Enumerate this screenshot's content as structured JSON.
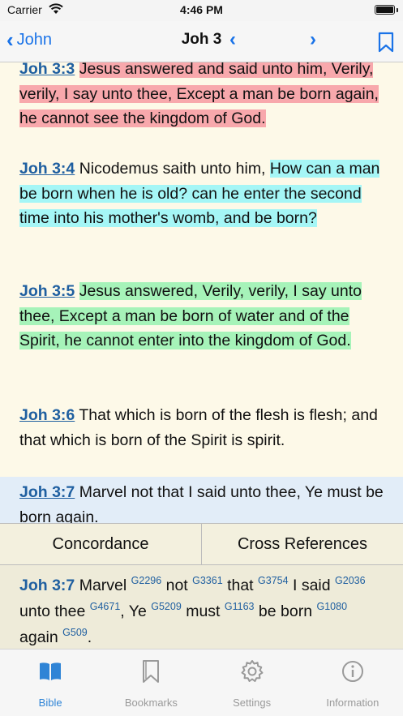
{
  "status_bar": {
    "carrier": "Carrier",
    "time": "4:46 PM"
  },
  "navbar": {
    "back_label": "John",
    "back_chevron": "‹",
    "title": "Joh 3",
    "prev_glyph": "‹",
    "next_glyph": "›"
  },
  "verses": [
    {
      "ref": "Joh 3:3",
      "plain": "",
      "highlighted": "Jesus answered and said unto him, Verily, verily, I say unto thee, Except a man be born again, he cannot see the kingdom of God.",
      "highlight_color": "#f8a8ac"
    },
    {
      "ref": "Joh 3:4",
      "plain": "Nicodemus saith unto him,",
      "highlighted": "How can a man be born when he is old? can he enter the second time into his mother's womb, and be born?",
      "highlight_color": "#a5f6f6"
    },
    {
      "ref": "Joh 3:5",
      "plain": "",
      "highlighted": "Jesus answered, Verily, verily, I say unto thee, Except a man be born of water and of the Spirit, he cannot enter into the kingdom of God.",
      "highlight_color": "#a6f3b9"
    },
    {
      "ref": "Joh 3:6",
      "plain": "That which is born of the flesh is flesh; and that which is born of the Spirit is spirit.",
      "highlighted": ""
    },
    {
      "ref": "Joh 3:7",
      "plain": "Marvel not that I said unto thee, Ye must be born again.",
      "highlighted": "",
      "selected": true
    }
  ],
  "panel_tabs": {
    "concordance": "Concordance",
    "cross_references": "Cross References"
  },
  "concordance": {
    "ref": "Joh 3:7",
    "words": [
      {
        "word": "Marvel",
        "strong": "G2296"
      },
      {
        "word": "not",
        "strong": "G3361"
      },
      {
        "word": "that",
        "strong": "G3754"
      },
      {
        "word": "I said",
        "strong": "G2036"
      },
      {
        "word": "unto thee",
        "strong": "G4671"
      },
      {
        "word": ", Ye",
        "strong": "G5209"
      },
      {
        "word": "must",
        "strong": "G1163"
      },
      {
        "word": "be born",
        "strong": "G1080"
      },
      {
        "word": "again",
        "strong": "G509"
      }
    ],
    "final_punct": "."
  },
  "tabbar": {
    "items": [
      {
        "label": "Bible",
        "icon": "book-icon",
        "active": true
      },
      {
        "label": "Bookmarks",
        "icon": "bookmark-icon",
        "active": false
      },
      {
        "label": "Settings",
        "icon": "gear-icon",
        "active": false
      },
      {
        "label": "Information",
        "icon": "info-icon",
        "active": false
      }
    ]
  },
  "colors": {
    "accent": "#1a73e8",
    "ref": "#1f5fa0",
    "tab_active": "#2f84d6",
    "background": "#fdf9e8"
  }
}
